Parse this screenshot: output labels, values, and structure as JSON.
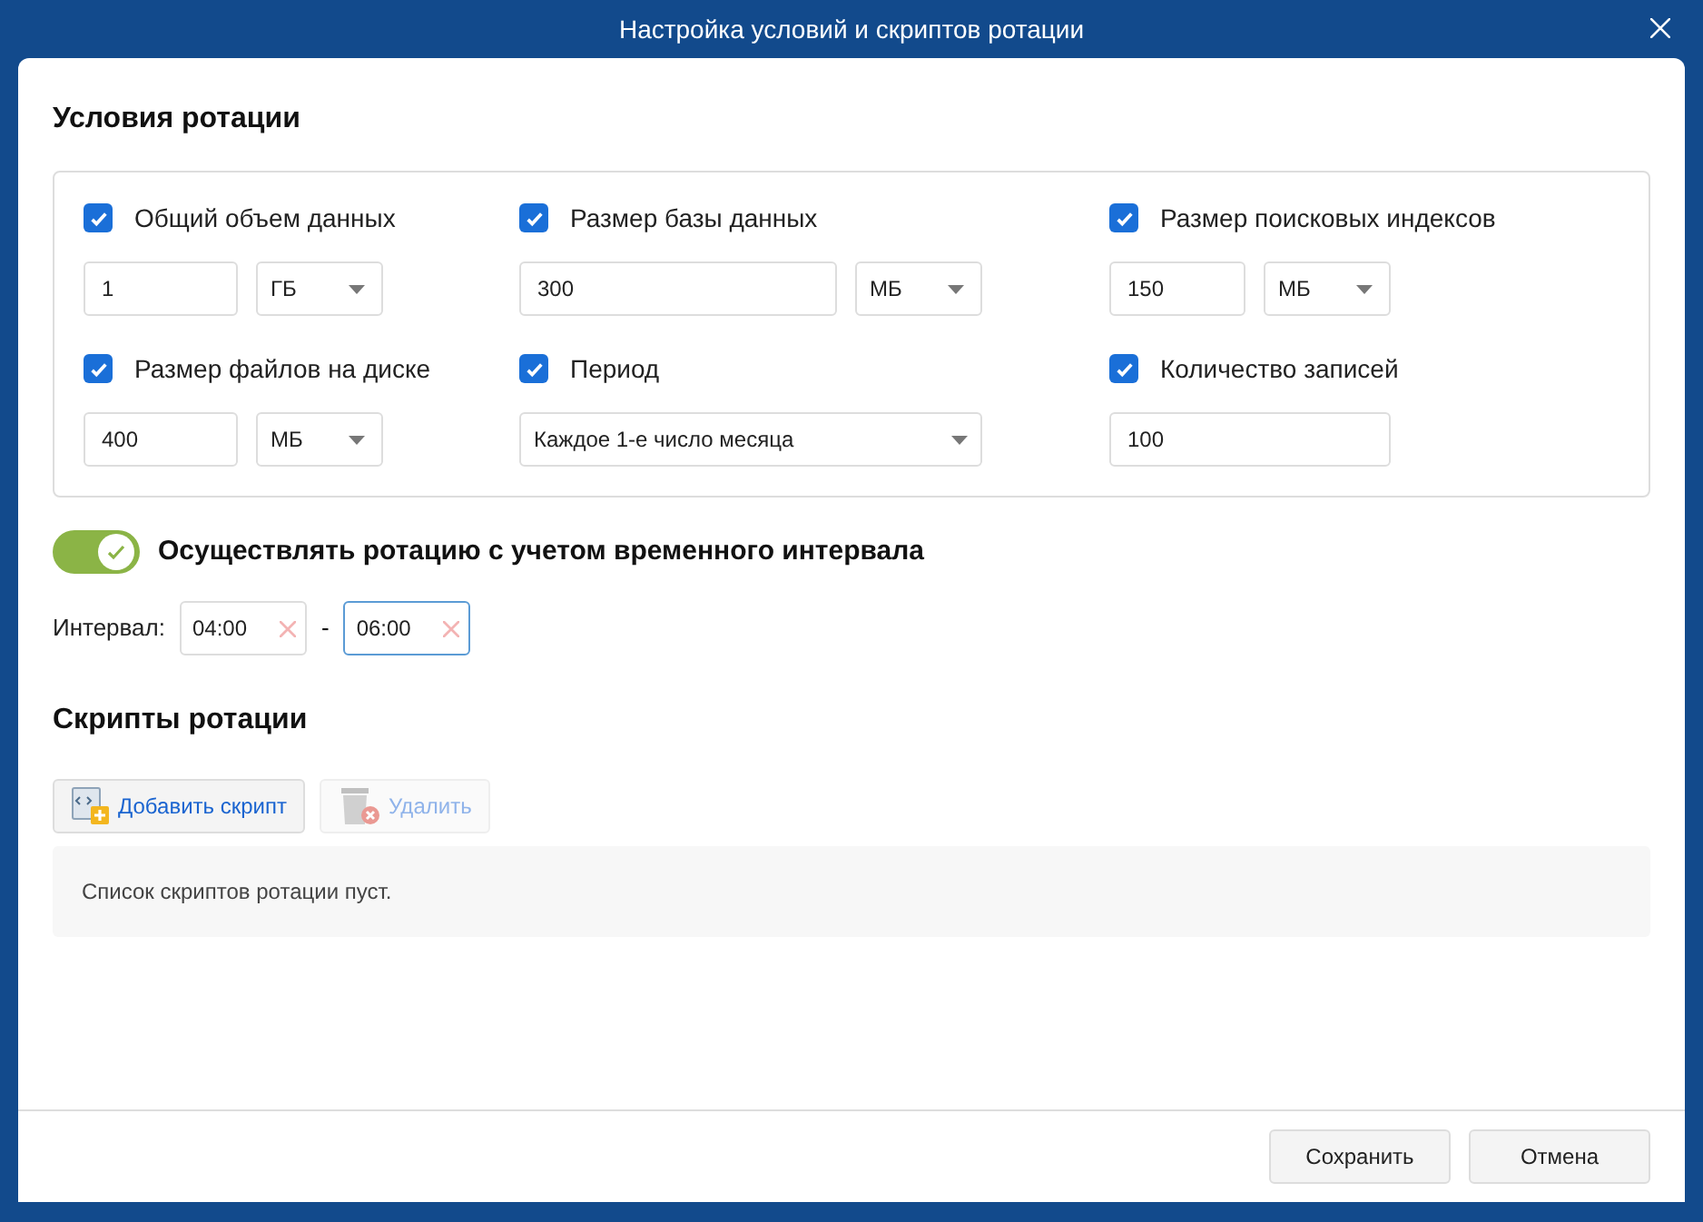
{
  "window": {
    "title": "Настройка условий и скриптов ротации"
  },
  "conditions": {
    "title": "Условия ротации",
    "items": [
      {
        "kind": "value_unit",
        "label": "Общий объем данных",
        "checked": true,
        "value": "1",
        "unit": "ГБ"
      },
      {
        "kind": "value_unit",
        "label": "Размер базы данных",
        "checked": true,
        "value": "300",
        "unit": "МБ"
      },
      {
        "kind": "value_unit",
        "label": "Размер поисковых индексов",
        "checked": true,
        "value": "150",
        "unit": "МБ"
      },
      {
        "kind": "value_unit",
        "label": "Размер файлов на диске",
        "checked": true,
        "value": "400",
        "unit": "МБ"
      },
      {
        "kind": "select",
        "label": "Период",
        "checked": true,
        "value": "Каждое 1-е число месяца"
      },
      {
        "kind": "value",
        "label": "Количество записей",
        "checked": true,
        "value": "100"
      }
    ]
  },
  "interval_toggle": {
    "label": "Осуществлять ротацию с учетом временного интервала",
    "on": true
  },
  "interval": {
    "label": "Интервал:",
    "separator": "-",
    "fields": [
      {
        "value": "04:00",
        "focused": false
      },
      {
        "value": "06:00",
        "focused": true
      }
    ]
  },
  "scripts": {
    "title": "Скрипты ротации",
    "buttons": [
      {
        "kind": "add",
        "label": "Добавить скрипт",
        "disabled": false
      },
      {
        "kind": "delete",
        "label": "Удалить",
        "disabled": true
      }
    ],
    "empty_message": "Список скриптов ротации пуст."
  },
  "footer": {
    "buttons": [
      "Сохранить",
      "Отмена"
    ]
  }
}
